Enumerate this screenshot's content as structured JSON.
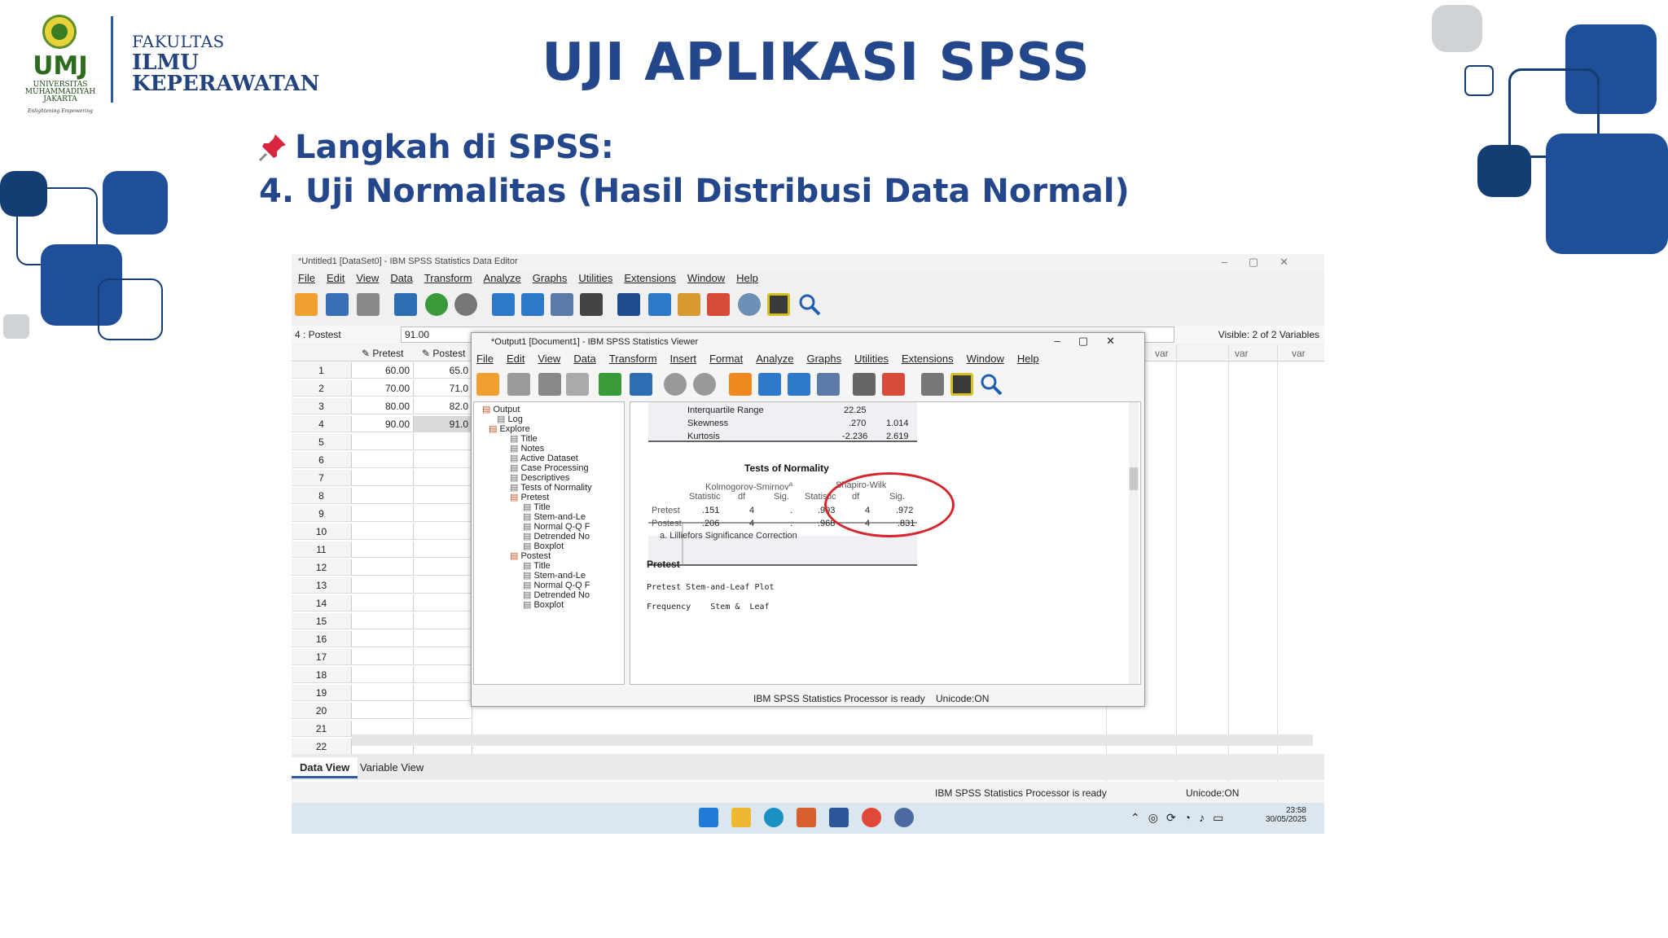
{
  "slide": {
    "title": "UJI APLIKASI SPSS",
    "heading": "Langkah di SPSS:",
    "subheading": "4. Uji Normalitas (Hasil Distribusi Data Normal)",
    "logo": {
      "abbr": "UMJ",
      "univ_line1": "UNIVERSITAS",
      "univ_line2": "MUHAMMADIYAH",
      "univ_line3": "JAKARTA",
      "motto": "Enlightening Empowering"
    },
    "faculty": {
      "line1": "FAKULTAS",
      "line2": "ILMU",
      "line3": "KEPERAWATAN"
    },
    "colors": {
      "primary": "#24478b",
      "dark": "#143d73",
      "accent_red": "#d6262d"
    }
  },
  "data_editor": {
    "window_title": "*Untitled1 [DataSet0] - IBM SPSS Statistics Data Editor",
    "menu": [
      "File",
      "Edit",
      "View",
      "Data",
      "Transform",
      "Analyze",
      "Graphs",
      "Utilities",
      "Extensions",
      "Window",
      "Help"
    ],
    "cell_ref": "4 : Postest",
    "cell_value": "91.00",
    "visible_vars": "Visible: 2 of 2 Variables",
    "columns": [
      "Pretest",
      "Postest"
    ],
    "var_headers": [
      "var",
      "var",
      "var"
    ],
    "rows": [
      {
        "n": "1",
        "pre": "60.00",
        "post": "65.0"
      },
      {
        "n": "2",
        "pre": "70.00",
        "post": "71.0"
      },
      {
        "n": "3",
        "pre": "80.00",
        "post": "82.0"
      },
      {
        "n": "4",
        "pre": "90.00",
        "post": "91.0"
      },
      {
        "n": "5"
      },
      {
        "n": "6"
      },
      {
        "n": "7"
      },
      {
        "n": "8"
      },
      {
        "n": "9"
      },
      {
        "n": "10"
      },
      {
        "n": "11"
      },
      {
        "n": "12"
      },
      {
        "n": "13"
      },
      {
        "n": "14"
      },
      {
        "n": "15"
      },
      {
        "n": "16"
      },
      {
        "n": "17"
      },
      {
        "n": "18"
      },
      {
        "n": "19"
      },
      {
        "n": "20"
      },
      {
        "n": "21"
      },
      {
        "n": "22"
      }
    ],
    "tabs": {
      "data_view": "Data View",
      "variable_view": "Variable View"
    },
    "status": "IBM SPSS Statistics Processor is ready",
    "unicode": "Unicode:ON"
  },
  "viewer": {
    "window_title": "*Output1 [Document1] - IBM SPSS Statistics Viewer",
    "menu": [
      "File",
      "Edit",
      "View",
      "Data",
      "Transform",
      "Insert",
      "Format",
      "Analyze",
      "Graphs",
      "Utilities",
      "Extensions",
      "Window",
      "Help"
    ],
    "tree": [
      "Output",
      "Log",
      "Explore",
      "Title",
      "Notes",
      "Active Dataset",
      "Case Processing",
      "Descriptives",
      "Tests of Normality",
      "Pretest",
      "Title",
      "Stem-and-Le",
      "Normal Q-Q F",
      "Detrended No",
      "Boxplot",
      "Postest",
      "Title",
      "Stem-and-Le",
      "Normal Q-Q F",
      "Detrended No",
      "Boxplot"
    ],
    "desc_rows": [
      {
        "label": "Interquartile Range",
        "stat": "22.25",
        "se": ""
      },
      {
        "label": "Skewness",
        "stat": ".270",
        "se": "1.014"
      },
      {
        "label": "Kurtosis",
        "stat": "-2.236",
        "se": "2.619"
      }
    ],
    "normality": {
      "title": "Tests of Normality",
      "ks_header": "Kolmogorov-Smirnov",
      "ks_sup": "a",
      "sw_header": "Shapiro-Wilk",
      "cols": [
        "Statistic",
        "df",
        "Sig.",
        "Statistic",
        "df",
        "Sig."
      ],
      "rows": [
        {
          "label": "Pretest",
          "ks_stat": ".151",
          "ks_df": "4",
          "ks_sig": ".",
          "sw_stat": ".993",
          "sw_df": "4",
          "sw_sig": ".972"
        },
        {
          "label": "Postest",
          "ks_stat": ".206",
          "ks_df": "4",
          "ks_sig": ".",
          "sw_stat": ".968",
          "sw_df": "4",
          "sw_sig": ".831"
        }
      ],
      "footnote": "a. Lilliefors Significance Correction"
    },
    "section_heading": "Pretest",
    "stemleaf_title": "Pretest Stem-and-Leaf Plot",
    "stemleaf_cols": "Frequency    Stem &  Leaf",
    "status": "IBM SPSS Statistics Processor is ready",
    "unicode": "Unicode:ON"
  },
  "taskbar": {
    "time": "23:58",
    "date": "30/05/2025"
  }
}
